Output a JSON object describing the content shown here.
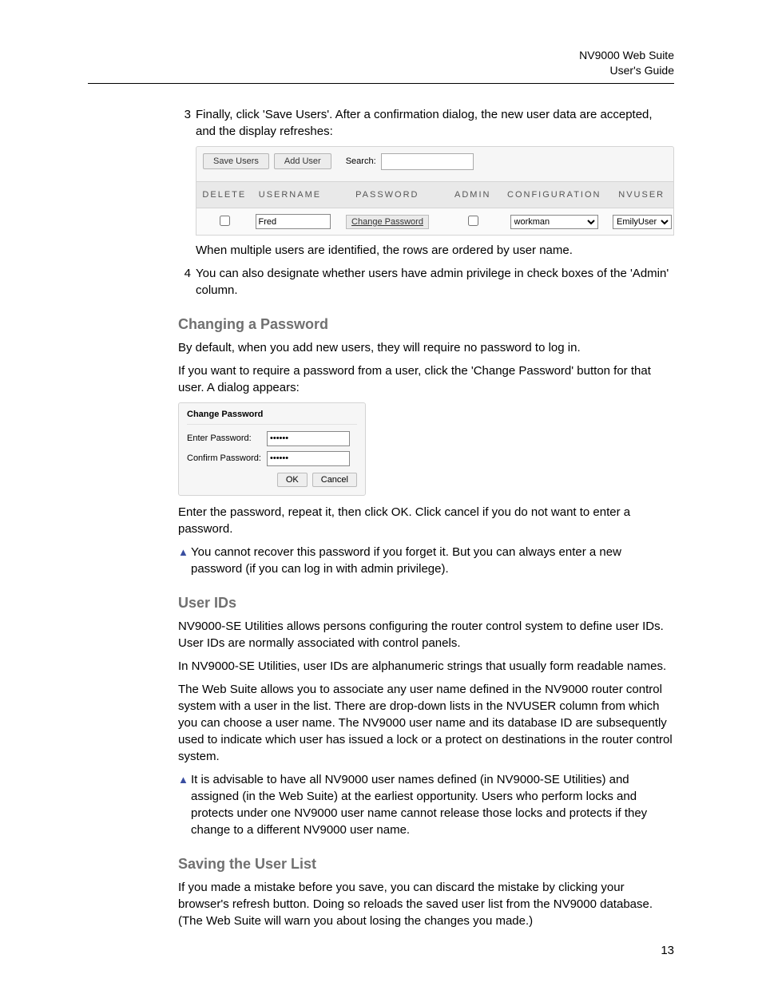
{
  "header": {
    "product": "NV9000 Web Suite",
    "doc": "User's Guide"
  },
  "page_number": "13",
  "steps": {
    "s3_num": "3",
    "s3_text": "Finally, click 'Save Users'. After a confirmation dialog, the new user data are accepted, and the display refreshes:",
    "s3_after": "When multiple users are identified, the rows are ordered by user name.",
    "s4_num": "4",
    "s4_text": "You can also designate whether users have admin privilege in check boxes of the 'Admin' column."
  },
  "toolbar": {
    "save_users": "Save Users",
    "add_user": "Add User",
    "search_label": "Search:",
    "search_value": ""
  },
  "table": {
    "headers": {
      "delete": "DELETE",
      "username": "USERNAME",
      "password": "PASSWORD",
      "admin": "ADMIN",
      "configuration": "CONFIGURATION",
      "nvuser": "NVUSER"
    },
    "row": {
      "username": "Fred",
      "password_btn": "Change Password",
      "configuration": "workman",
      "nvuser": "EmilyUser"
    }
  },
  "sec_change_password": {
    "heading": "Changing a Password",
    "p1": "By default, when you add new users, they will require no password to log in.",
    "p2": "If you want to require a password from a user, click the 'Change Password' button for that user. A dialog appears:",
    "p3": "Enter the password, repeat it, then click OK. Click cancel if you do not want to enter a password.",
    "note": "You cannot recover this password if you forget it. But you can always enter a new password (if you can log in with admin privilege)."
  },
  "dialog": {
    "title": "Change Password",
    "enter_label": "Enter Password:",
    "confirm_label": "Confirm Password:",
    "value": "••••••",
    "ok": "OK",
    "cancel": "Cancel"
  },
  "sec_user_ids": {
    "heading": "User IDs",
    "p1": "NV9000-SE Utilities allows persons configuring the router control system to define user IDs. User IDs are normally associated with control panels.",
    "p2": "In NV9000-SE Utilities, user IDs are alphanumeric strings that usually form readable names.",
    "p3": "The Web Suite allows you to associate any user name defined in the NV9000 router control system with a user in the list. There are drop-down lists in the NVUSER column from which you can choose a user name. The NV9000 user name and its database ID are subsequently used to indicate which user has issued a lock or a protect on destinations in the router control system.",
    "note": "It is advisable to have all NV9000 user names defined (in NV9000-SE Utilities) and assigned (in the Web Suite) at the earliest opportunity. Users who perform locks and protects under one NV9000 user name cannot release those locks and protects if they change to a different NV9000 user name."
  },
  "sec_saving": {
    "heading": "Saving the User List",
    "p1": "If you made a mistake before you save, you can discard the mistake by clicking your browser's refresh button. Doing so reloads the saved user list from the NV9000 database. (The Web Suite will warn you about losing the changes you made.)"
  }
}
